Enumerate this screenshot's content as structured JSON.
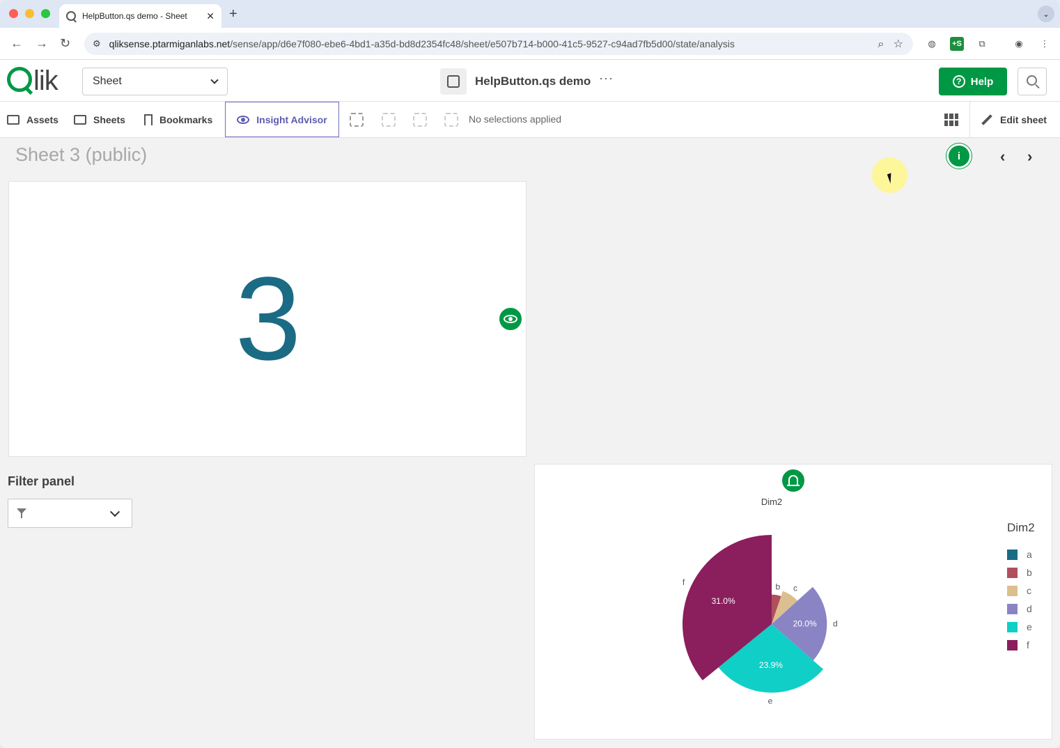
{
  "browser": {
    "tab_title": "HelpButton.qs demo - Sheet",
    "url_host": "qliksense.ptarmiganlabs.net",
    "url_path": "/sense/app/d6e7f080-ebe6-4bd1-a35d-bd8d2354fc48/sheet/e507b714-b000-41c5-9527-c94ad7fb5d00/state/analysis"
  },
  "header": {
    "logo": "lik",
    "mode_select": "Sheet",
    "app_title": "HelpButton.qs demo",
    "more_label": "···",
    "help_label": "Help"
  },
  "toolbar": {
    "assets": "Assets",
    "sheets": "Sheets",
    "bookmarks": "Bookmarks",
    "insight_advisor": "Insight Advisor",
    "no_selections": "No selections applied",
    "edit_sheet": "Edit sheet"
  },
  "sheet": {
    "title": "Sheet 3 (public)",
    "kpi_value": "3",
    "filter_label": "Filter panel"
  },
  "colors": {
    "qlik_green": "#009845",
    "kpi_text": "#1b6b85",
    "insight_accent": "#5c5cb0"
  },
  "chart_data": {
    "type": "pie",
    "title": "Dim2",
    "legend_title": "Dim2",
    "legend_position": "right",
    "slices": [
      {
        "label": "a",
        "color": "#1a6b86",
        "pct": 0.0,
        "radius_frac": 0.0
      },
      {
        "label": "b",
        "color": "#b0505e",
        "pct": 4.5,
        "radius_frac": 0.33
      },
      {
        "label": "c",
        "color": "#dbbf8e",
        "pct": 7.0,
        "radius_frac": 0.39
      },
      {
        "label": "d",
        "color": "#8a84c5",
        "pct": 20.0,
        "radius_frac": 0.62
      },
      {
        "label": "e",
        "color": "#10cfc6",
        "pct": 23.9,
        "radius_frac": 0.77
      },
      {
        "label": "f",
        "color": "#8b1e5c",
        "pct": 31.0,
        "radius_frac": 1.0
      }
    ],
    "data_labels": [
      "31.0%",
      "20.0%",
      "23.9%"
    ]
  }
}
